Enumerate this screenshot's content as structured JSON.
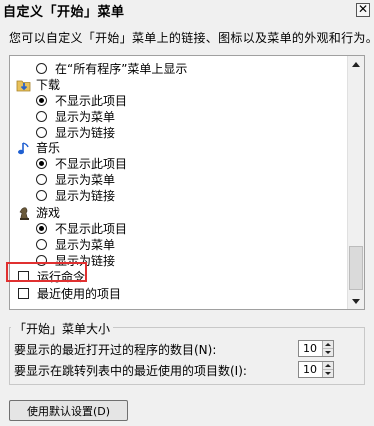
{
  "window": {
    "title": "自定义「开始」菜单",
    "close_label": "✕"
  },
  "description": "您可以自定义「开始」菜单上的链接、图标以及菜单的外观和行为。",
  "list": {
    "items": [
      {
        "label": "在“所有程序”菜单上显示"
      },
      {
        "label": "下载"
      },
      {
        "label": "不显示此项目"
      },
      {
        "label": "显示为菜单"
      },
      {
        "label": "显示为链接"
      },
      {
        "label": "音乐"
      },
      {
        "label": "不显示此项目"
      },
      {
        "label": "显示为菜单"
      },
      {
        "label": "显示为链接"
      },
      {
        "label": "游戏"
      },
      {
        "label": "不显示此项目"
      },
      {
        "label": "显示为菜单"
      },
      {
        "label": "显示为链接"
      },
      {
        "label": "运行命令"
      },
      {
        "label": "最近使用的项目"
      }
    ]
  },
  "menu_size": {
    "legend": "「开始」菜单大小",
    "recent_programs_label": "要显示的最近打开过的程序的数目(N):",
    "recent_programs_value": "10",
    "jump_list_label": "要显示在跳转列表中的最近使用的项目数(I):",
    "jump_list_value": "10"
  },
  "default_button": "使用默认设置(D)"
}
